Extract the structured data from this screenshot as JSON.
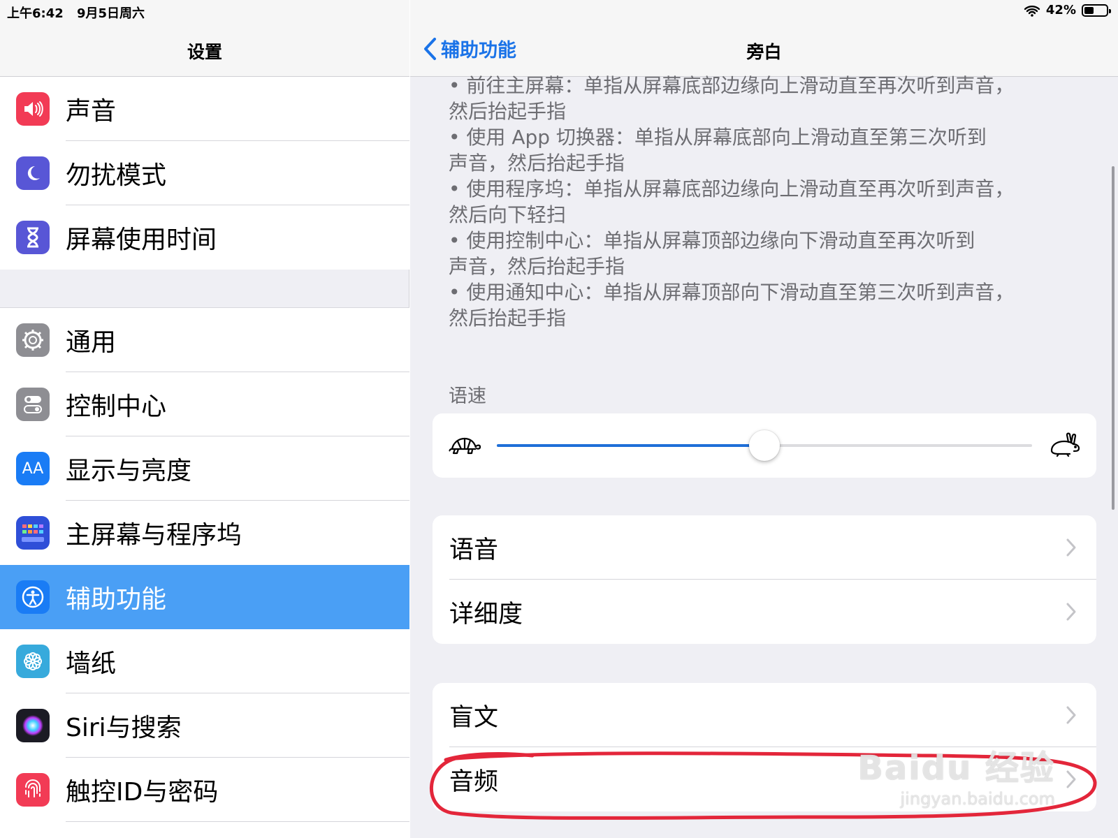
{
  "status": {
    "time": "上午6:42",
    "date": "9月5日周六",
    "battery": "42%",
    "battery_level": 0.42
  },
  "sidebar": {
    "title": "设置",
    "group1": [
      {
        "label": "声音",
        "icon": "speaker-icon",
        "color": "#f23b55"
      },
      {
        "label": "勿扰模式",
        "icon": "moon-icon",
        "color": "#5856d6"
      },
      {
        "label": "屏幕使用时间",
        "icon": "hourglass-icon",
        "color": "#5856d6"
      }
    ],
    "group2": [
      {
        "label": "通用",
        "icon": "gear-icon",
        "color": "#8e8e93"
      },
      {
        "label": "控制中心",
        "icon": "toggles-icon",
        "color": "#8e8e93"
      },
      {
        "label": "显示与亮度",
        "icon": "aa-icon",
        "color": "#1a7cf5"
      },
      {
        "label": "主屏幕与程序坞",
        "icon": "grid-icon",
        "color": "#2f4fd8"
      },
      {
        "label": "辅助功能",
        "icon": "accessibility-icon",
        "color": "#1a7cf5",
        "selected": true
      },
      {
        "label": "墙纸",
        "icon": "flower-icon",
        "color": "#37aadc"
      },
      {
        "label": "Siri与搜索",
        "icon": "siri-icon",
        "color": "#222"
      },
      {
        "label": "触控ID与密码",
        "icon": "fingerprint-icon",
        "color": "#f23b55"
      }
    ]
  },
  "detail": {
    "back_label": "辅助功能",
    "title": "旁白",
    "help_lines": [
      "• 前往主屏幕：单指从屏幕底部边缘向上滑动直至再次听到声音，",
      "然后抬起手指",
      "• 使用 App 切换器：单指从屏幕底部向上滑动直至第三次听到",
      "声音，然后抬起手指",
      "• 使用程序坞：单指从屏幕底部边缘向上滑动直至再次听到声音，",
      "然后向下轻扫",
      "• 使用控制中心：单指从屏幕顶部边缘向下滑动直至再次听到",
      "声音，然后抬起手指",
      "• 使用通知中心：单指从屏幕顶部向下滑动直至第三次听到声音，",
      "然后抬起手指"
    ],
    "speech_rate_label": "语速",
    "speech_rate_value": 0.5,
    "list1": [
      {
        "label": "语音"
      },
      {
        "label": "详细度"
      }
    ],
    "list2": [
      {
        "label": "盲文"
      },
      {
        "label": "音频"
      }
    ],
    "annotation_color": "#e3263a"
  },
  "watermark": {
    "line1": "Baidu 经验",
    "line2": "jingyan.baidu.com"
  }
}
